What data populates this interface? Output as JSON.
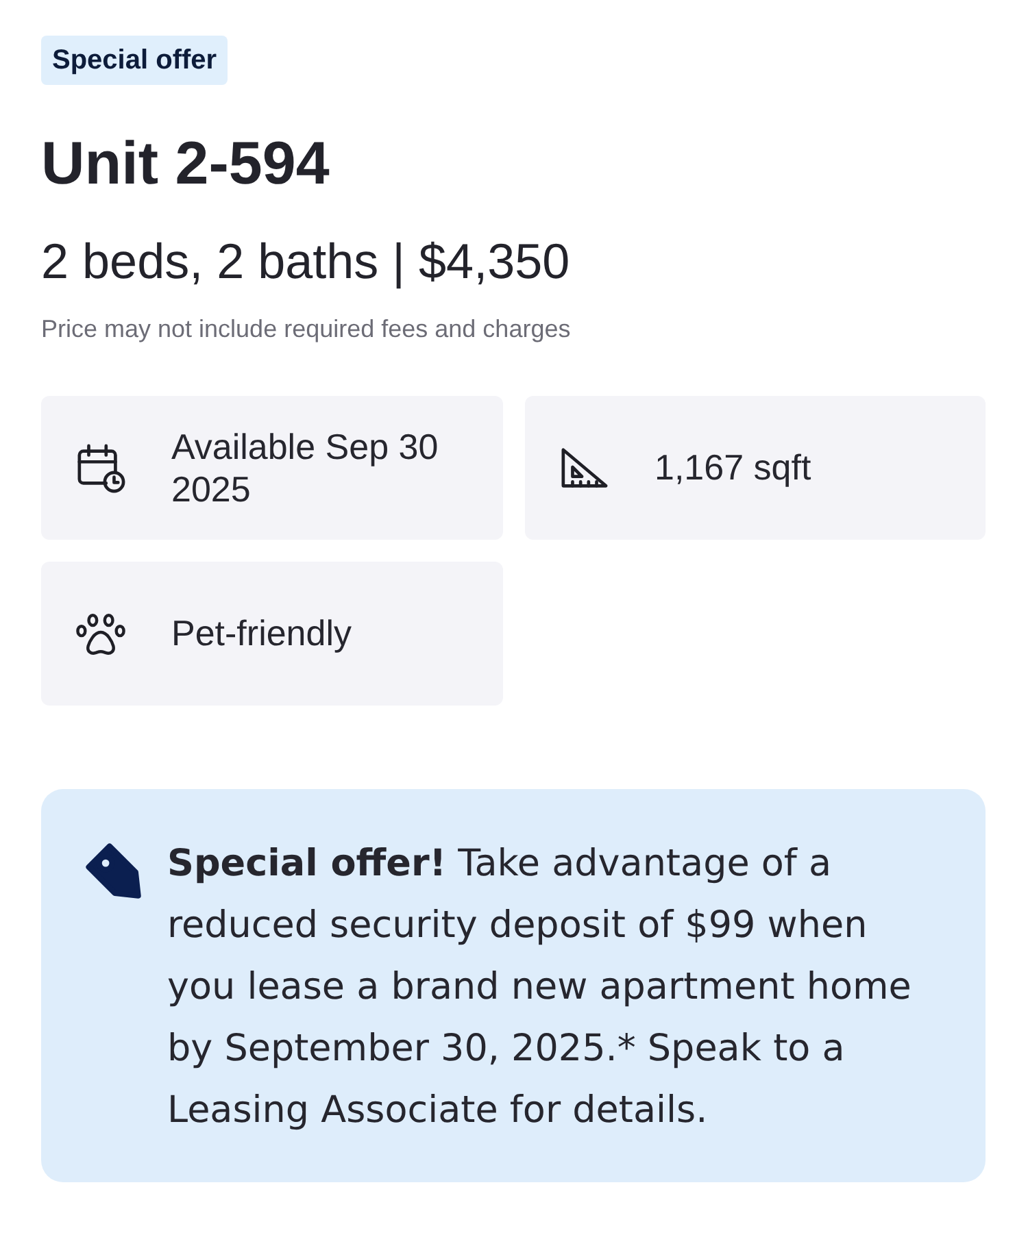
{
  "badge": "Special offer",
  "title": "Unit 2-594",
  "summary": "2 beds, 2 baths | $4,350",
  "disclaimer": "Price may not include required fees and charges",
  "features": [
    {
      "kind": "calendar",
      "text": "Available Sep 30 2025"
    },
    {
      "kind": "area",
      "text": "1,167 sqft"
    },
    {
      "kind": "pets",
      "text": "Pet-friendly"
    }
  ],
  "offer": {
    "text": "**Special offer!** Take advantage of a reduced security deposit of $99 when you lease a brand new apartment home by September 30, 2025.* Speak to a Leasing Associate for details."
  }
}
